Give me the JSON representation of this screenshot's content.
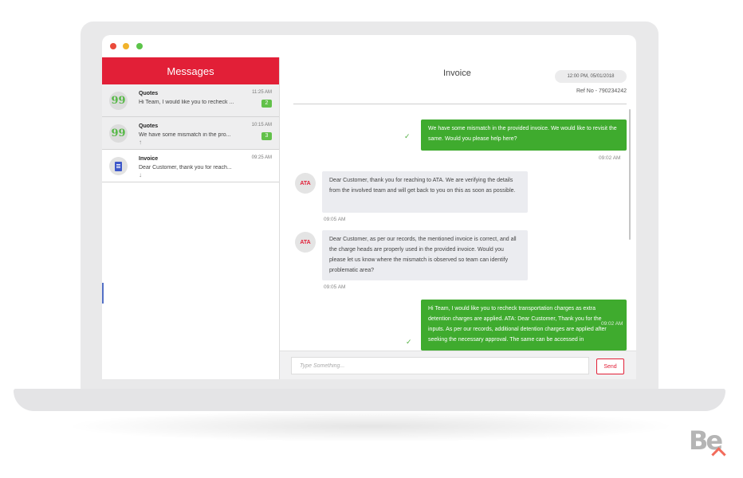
{
  "window": {
    "controls": [
      "close",
      "minimize",
      "maximize"
    ]
  },
  "sidebar": {
    "title": "Messages",
    "conversations": [
      {
        "title": "Quotes",
        "preview": "Hi Team, I would like you to recheck ...",
        "time": "11:25 AM",
        "badge": "2",
        "icon": "quote-icon",
        "arrow": ""
      },
      {
        "title": "Quotes",
        "preview": "We have some mismatch in the pro...",
        "time": "10:15 AM",
        "badge": "3",
        "icon": "quote-icon",
        "arrow": "↑"
      },
      {
        "title": "Invoice",
        "preview": "Dear Customer, thank you for reach...",
        "time": "09:25 AM",
        "badge": "",
        "icon": "document-icon",
        "arrow": "↓"
      }
    ]
  },
  "chat": {
    "title": "Invoice",
    "datetime": "12:00 PM, 05/01/2018",
    "ref": "Ref No - 790234242",
    "messages": [
      {
        "direction": "out",
        "text": "We have some mismatch in the provided invoice. We would like to revisit the same. Would you please help here?",
        "time": "09:02 AM"
      },
      {
        "direction": "in",
        "sender_logo": "ATA",
        "text": "Dear Customer, thank you for reaching to ATA. We are verifying the details from the involved team and will get back to you on this as soon as possible.",
        "time": "09:05 AM"
      },
      {
        "direction": "in",
        "sender_logo": "ATA",
        "text": "Dear Customer, as per our records, the mentioned invoice is correct, and all the charge heads are properly used in the provided invoice. Would you please let us know where the mismatch is observed so team can identify problematic area?",
        "time": "09:05 AM"
      },
      {
        "direction": "out",
        "text": "Hi Team, I would like you to recheck transportation charges as extra detention charges are applied. ATA: Dear Customer, Thank you for the inputs. As per our records, additional detention charges are applied after seeking the necessary approval. The same can be accessed in",
        "time": "09:02 AM"
      }
    ]
  },
  "composer": {
    "placeholder": "Type Something...",
    "send_label": "Send"
  },
  "branding": {
    "logo_text": "Be"
  },
  "colors": {
    "accent": "#e21f37",
    "outgoing": "#3fab2e",
    "incoming": "#ebecf0",
    "badge": "#62c14a"
  }
}
